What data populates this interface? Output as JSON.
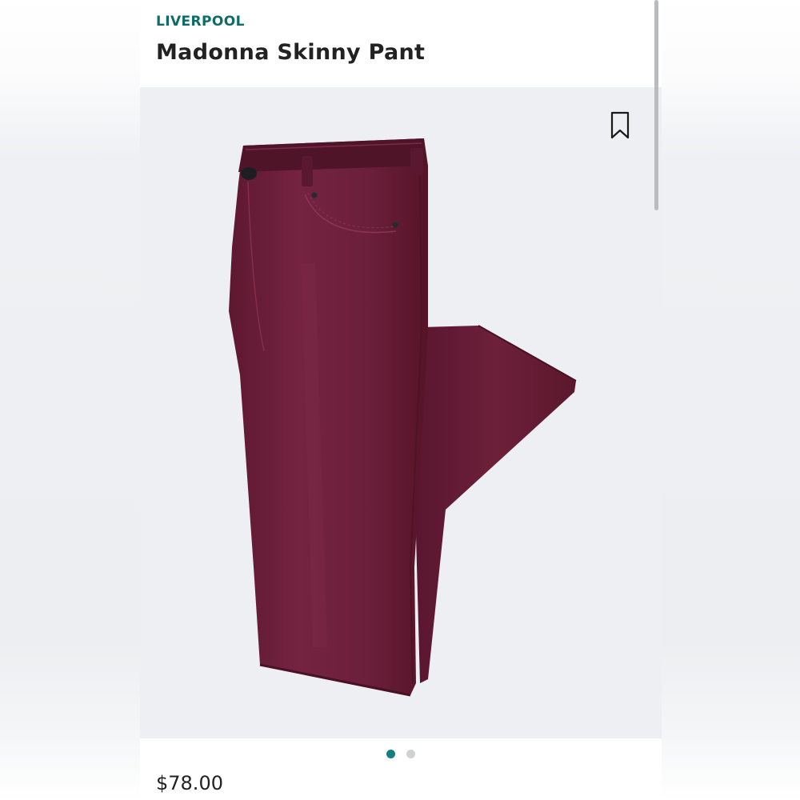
{
  "product": {
    "brand": "LIVERPOOL",
    "name": "Madonna Skinny Pant",
    "price": "$78.00",
    "image": {
      "subject": "burgundy skinny pants",
      "garment_color": "#6e1f38",
      "background_color": "#eeeff2"
    },
    "gallery": {
      "total_images": 2,
      "active_index": 0
    },
    "bookmark_icon": "bookmark-icon"
  },
  "theme": {
    "accent": "#0f6b68",
    "dot_active": "#137f80",
    "dot_inactive": "#cfd1d4",
    "text": "#222222"
  }
}
